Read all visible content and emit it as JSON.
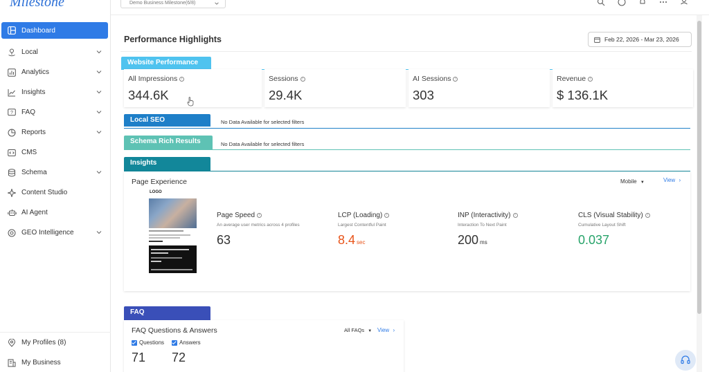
{
  "brand": {
    "logo_text": "Milestone"
  },
  "topbar": {
    "business_select": "Demo Business Milestone(6/8)"
  },
  "sidebar": {
    "items": [
      {
        "label": "Dashboard",
        "icon": "dashboard-icon",
        "active": true,
        "expandable": false
      },
      {
        "label": "Local",
        "icon": "local-pin-icon",
        "expandable": true
      },
      {
        "label": "Analytics",
        "icon": "analytics-bars-icon",
        "expandable": true
      },
      {
        "label": "Insights",
        "icon": "insights-line-icon",
        "expandable": true
      },
      {
        "label": "FAQ",
        "icon": "faq-icon",
        "expandable": true
      },
      {
        "label": "Reports",
        "icon": "reports-pie-icon",
        "expandable": true
      },
      {
        "label": "CMS",
        "icon": "cms-icon",
        "expandable": false
      },
      {
        "label": "Schema",
        "icon": "schema-db-icon",
        "expandable": true
      },
      {
        "label": "Content Studio",
        "icon": "sparkle-icon",
        "expandable": false
      },
      {
        "label": "AI Agent",
        "icon": "robot-icon",
        "expandable": false
      },
      {
        "label": "GEO Intelligence",
        "icon": "geo-target-icon",
        "expandable": true
      }
    ],
    "bottom_items": [
      {
        "label": "My Profiles (8)",
        "icon": "location-pin-icon"
      },
      {
        "label": "My Business",
        "icon": "building-icon"
      }
    ]
  },
  "main": {
    "title": "Performance Highlights",
    "date_range": "Feb 22, 2026 - Mar 23, 2026",
    "sections": {
      "website_performance": "Website Performance",
      "local_seo": "Local SEO",
      "schema_rich_results": "Schema Rich Results",
      "insights": "Insights",
      "faq": "FAQ"
    },
    "no_data_text": "No Data Available for selected filters",
    "metrics": [
      {
        "label": "All Impressions",
        "value": "344.6K"
      },
      {
        "label": "Sessions",
        "value": "29.4K"
      },
      {
        "label": "AI Sessions",
        "value": "303"
      },
      {
        "label": "Revenue",
        "value": "$ 136.1K"
      }
    ],
    "page_experience": {
      "title": "Page Experience",
      "device": "Mobile",
      "view_label": "View",
      "thumb_logo": "LOGO",
      "metrics": [
        {
          "label": "Page Speed",
          "sub": "An average user metrics across 4 profiles",
          "value": "63",
          "unit": "",
          "color": "#333333"
        },
        {
          "label": "LCP (Loading)",
          "sub": "Largest Contentful Paint",
          "value": "8.4",
          "unit": "sec",
          "color": "#e8541a"
        },
        {
          "label": "INP (Interactivity)",
          "sub": "Interaction To Next Paint",
          "value": "200",
          "unit": "ms",
          "color": "#333333"
        },
        {
          "label": "CLS (Visual Stability)",
          "sub": "Cumulative Layout Shift",
          "value": "0.037",
          "unit": "",
          "color": "#27a36a"
        }
      ]
    },
    "faq": {
      "title": "FAQ Questions & Answers",
      "filter": "All FAQs",
      "view_label": "View",
      "checkbox_questions": "Questions",
      "checkbox_answers": "Answers",
      "questions_count": "71",
      "answers_count": "72"
    }
  },
  "colors": {
    "accent": "#2f7be6",
    "website_performance_tab": "#4fc3ef",
    "local_seo_tab": "#1e7fc8",
    "schema_tab": "#5ec2b4",
    "insights_tab": "#12879a",
    "faq_tab": "#3a4fb8"
  }
}
